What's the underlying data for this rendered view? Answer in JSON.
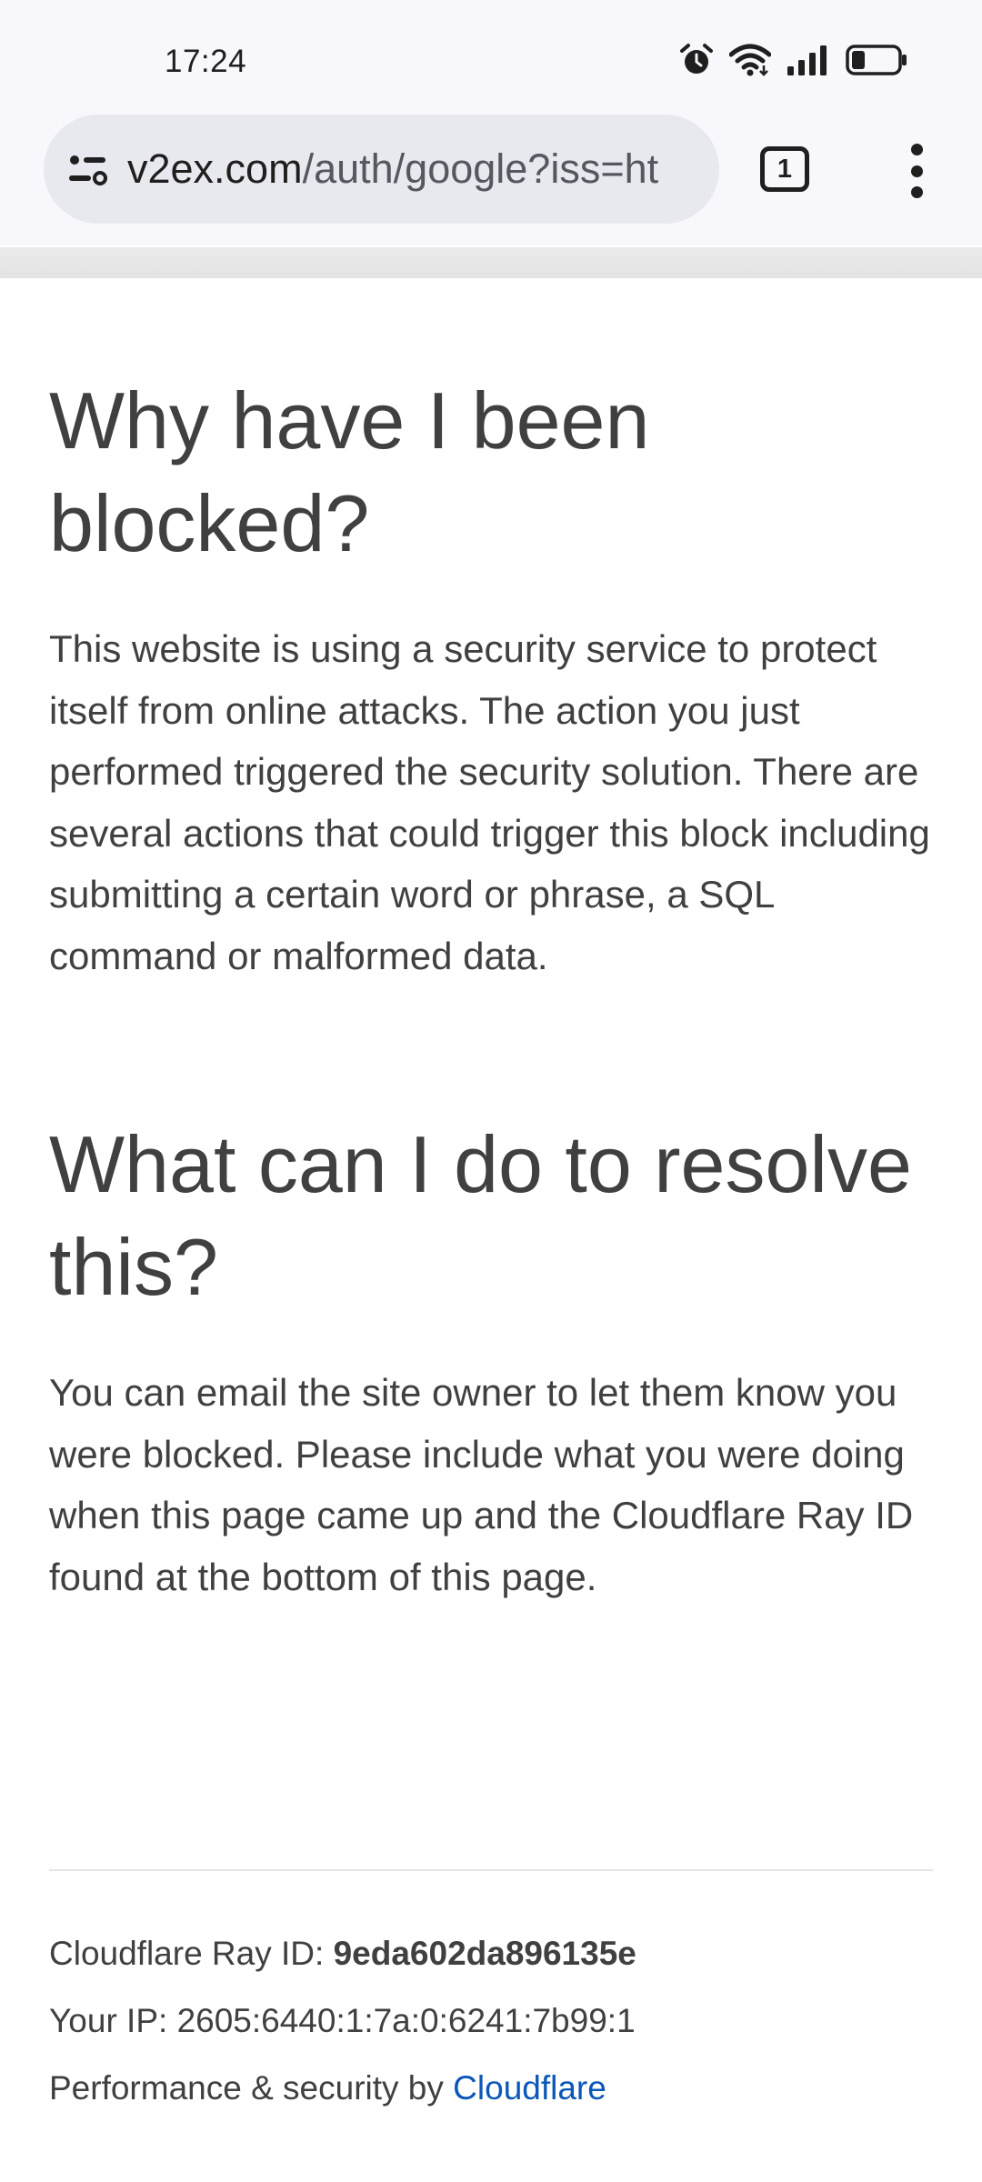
{
  "status_bar": {
    "time": "17:24",
    "icons": [
      "alarm-icon",
      "wifi-icon",
      "cell-signal-icon",
      "battery-icon"
    ]
  },
  "browser": {
    "url_domain": "v2ex.com",
    "url_path": "/auth/google?iss=ht",
    "tab_count": "1",
    "icons": [
      "site-settings-icon",
      "tab-switcher-icon",
      "more-menu-icon"
    ]
  },
  "page": {
    "heading_1": "Why have I been blocked?",
    "paragraph_1": "This website is using a security service to protect itself from online attacks. The action you just performed triggered the security solution. There are several actions that could trigger this block including submitting a certain word or phrase, a SQL command or malformed data.",
    "heading_2": "What can I do to resolve this?",
    "paragraph_2": "You can email the site owner to let them know you were blocked. Please include what you were doing when this page came up and the Cloudflare Ray ID found at the bottom of this page."
  },
  "footer": {
    "ray_label": "Cloudflare Ray ID:",
    "ray_id": "9eda602da896135e",
    "ip_label": "Your IP:",
    "ip_value": "2605:6440:1:7a:0:6241:7b99:1",
    "perf_label": "Performance & security by",
    "cloudflare_link": "Cloudflare"
  },
  "colors": {
    "text": "#404040",
    "link": "#0b57b8",
    "chrome_bg": "#f7f7fc"
  }
}
